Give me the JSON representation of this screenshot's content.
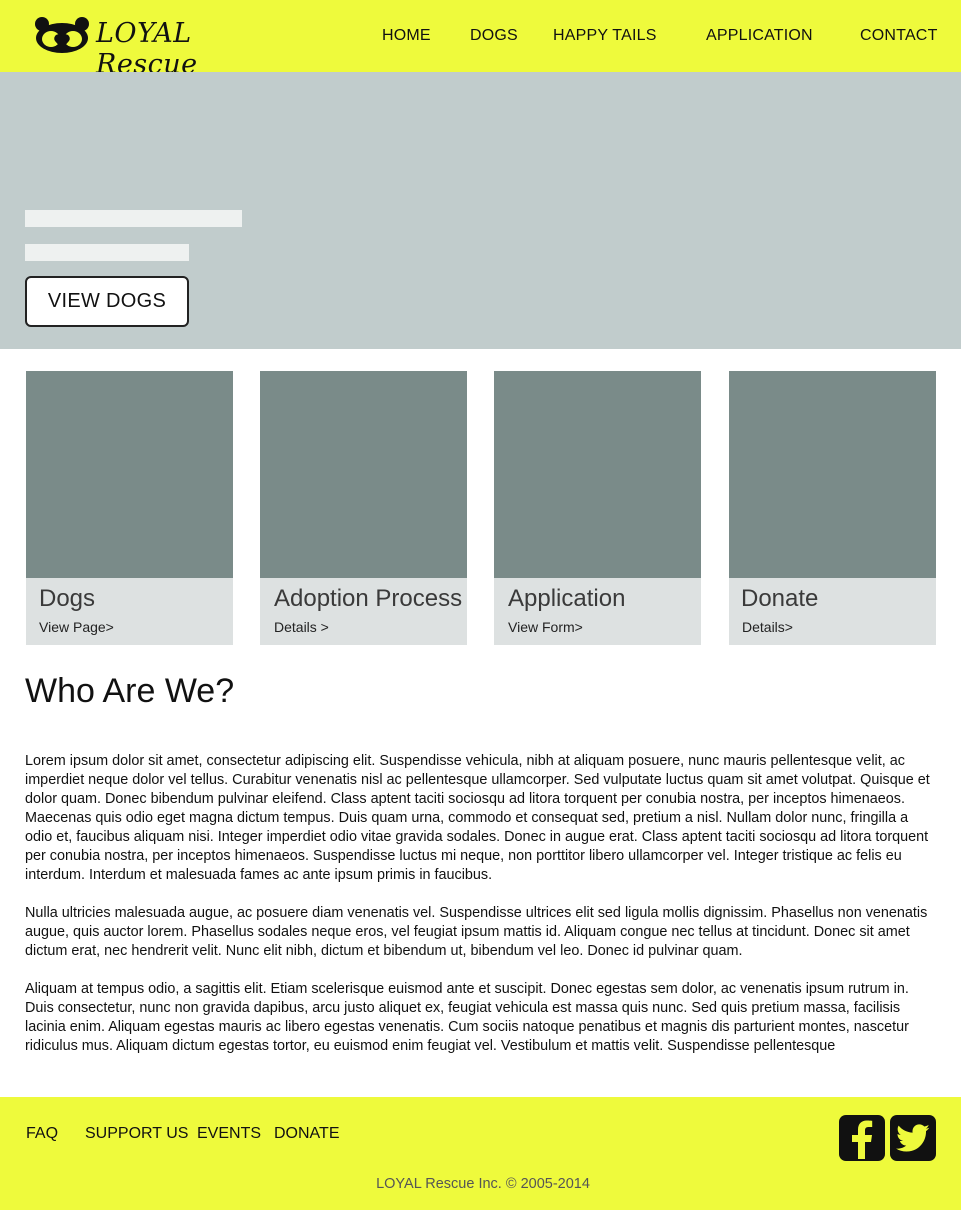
{
  "brand": {
    "name": "LOYAL Rescue"
  },
  "nav": {
    "home": "HOME",
    "dogs": "DOGS",
    "happy_tails": "HAPPY TAILS",
    "application": "APPLICATION",
    "contact": "CONTACT"
  },
  "hero": {
    "button_label": "VIEW DOGS"
  },
  "cards": [
    {
      "title": "Dogs",
      "link": "View Page>"
    },
    {
      "title": "Adoption Process",
      "link": "Details >"
    },
    {
      "title": "Application",
      "link": "View Form>"
    },
    {
      "title": "Donate",
      "link": "Details>"
    }
  ],
  "about": {
    "title": "Who Are We?",
    "paragraphs": [
      "Lorem ipsum dolor sit amet, consectetur adipiscing elit. Suspendisse vehicula, nibh at aliquam posuere, nunc mauris pellentesque velit, ac imperdiet neque dolor vel tellus. Curabitur venenatis nisl ac pellentesque ullamcorper. Sed vulputate luctus quam sit amet volutpat. Quisque et dolor quam. Donec bibendum pulvinar eleifend. Class aptent taciti sociosqu ad litora torquent per conubia nostra, per inceptos himenaeos. Maecenas quis odio eget magna dictum tempus. Duis quam urna, commodo et consequat sed, pretium a nisl. Nullam dolor nunc, fringilla a odio et, faucibus aliquam nisi. Integer imperdiet odio vitae gravida sodales. Donec in augue erat. Class aptent taciti sociosqu ad litora torquent per conubia nostra, per inceptos himenaeos. Suspendisse luctus mi neque, non porttitor libero ullamcorper vel. Integer tristique ac felis eu interdum. Interdum et malesuada fames ac ante ipsum primis in faucibus.",
      "Nulla ultricies malesuada augue, ac posuere diam venenatis vel. Suspendisse ultrices elit sed ligula mollis dignissim. Phasellus non venenatis augue, quis auctor lorem. Phasellus sodales neque eros, vel feugiat ipsum mattis id. Aliquam congue nec tellus at tincidunt. Donec sit amet dictum erat, nec hendrerit velit. Nunc elit nibh, dictum et bibendum ut, bibendum vel leo. Donec id pulvinar quam.",
      "Aliquam at tempus odio, a sagittis elit. Etiam scelerisque euismod ante et suscipit. Donec egestas sem dolor, ac venenatis ipsum rutrum in. Duis consectetur, nunc non gravida dapibus, arcu justo aliquet ex, feugiat vehicula est massa quis nunc. Sed quis pretium massa, facilisis lacinia enim. Aliquam egestas mauris ac libero egestas venenatis. Cum sociis natoque penatibus et magnis dis parturient montes, nascetur ridiculus mus. Aliquam dictum egestas tortor, eu euismod enim feugiat vel. Vestibulum et mattis velit. Suspendisse pellentesque"
    ]
  },
  "footer": {
    "faq": "FAQ",
    "support_us": "SUPPORT US",
    "events": "EVENTS",
    "donate": "DONATE",
    "copyright": "LOYAL Rescue Inc. © 2005-2014"
  },
  "icons": {
    "logo": "dog-heart-logo-icon",
    "facebook": "facebook-icon",
    "twitter": "twitter-icon"
  },
  "colors": {
    "accent_yellow": "#eefa3c",
    "hero_bg": "#c1cccc",
    "card_image": "#7a8b89",
    "card_caption": "#dde1e1"
  }
}
